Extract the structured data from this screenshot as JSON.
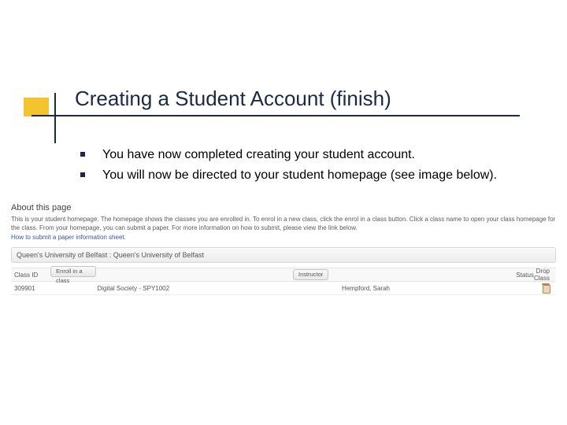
{
  "title": "Creating a Student Account (finish)",
  "bullets": [
    "You have now completed creating your student account.",
    "You will now be directed to your student homepage (see image below)."
  ],
  "about": {
    "heading": "About this page",
    "body": "This is your student homepage. The homepage shows the classes you are enrolled in. To enrol in a new class, click the enrol in a class button. Click a class name to open your class homepage for the class. From your homepage, you can submit a paper. For more information on how to submit, please view the link below.",
    "link": "How to submit a paper information sheet."
  },
  "breadcrumb": "Queen's University of Belfast : Queen's University of Belfast",
  "table": {
    "headers": {
      "class_id": "Class ID",
      "enroll": "Enroll in a class",
      "instructor": "Instructor",
      "status": "Status",
      "drop": "Drop Class"
    },
    "row": {
      "class_id": "309901",
      "class_name": "Digital Society - SPY1002",
      "instructor": "Hempford, Sarah"
    }
  }
}
